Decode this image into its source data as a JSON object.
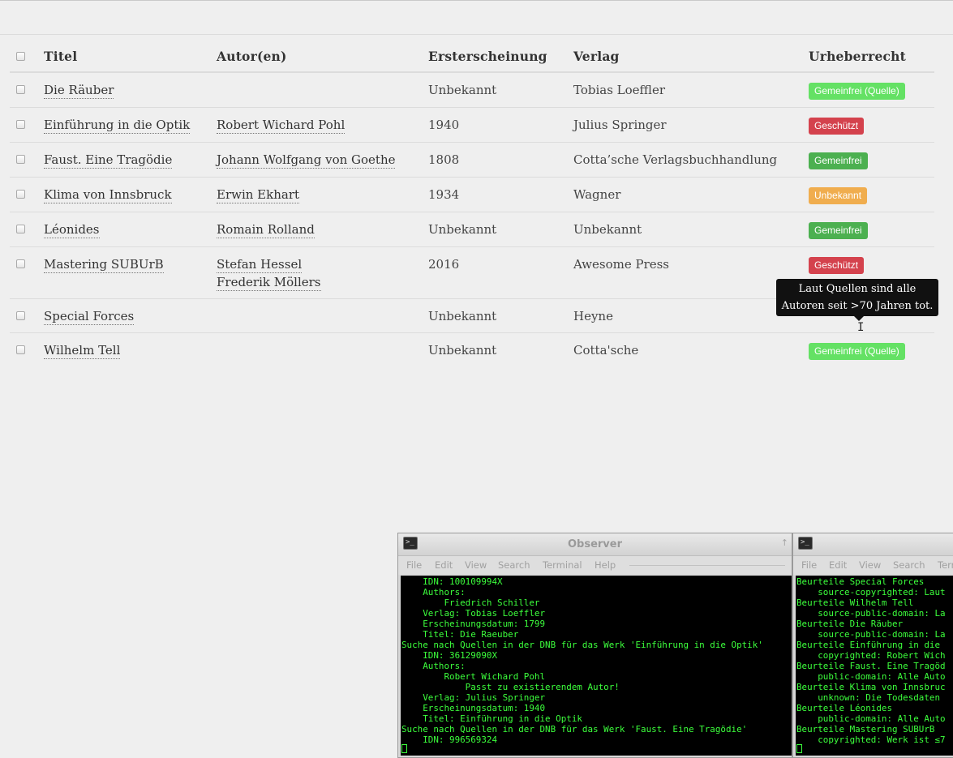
{
  "table": {
    "headers": [
      "Titel",
      "Autor(en)",
      "Ersterscheinung",
      "Verlag",
      "Urheberrecht"
    ],
    "rows": [
      {
        "title": "Die Räuber",
        "authors": [],
        "year": "Unbekannt",
        "publisher": "Tobias Loeffler",
        "copyright": "Gemeinfrei (Quelle)",
        "badge_color": "#64e164"
      },
      {
        "title": "Einführung in die Optik",
        "authors": [
          "Robert Wichard Pohl"
        ],
        "year": "1940",
        "publisher": "Julius Springer",
        "copyright": "Geschützt",
        "badge_color": "#d4424d"
      },
      {
        "title": "Faust. Eine Tragödie",
        "authors": [
          "Johann Wolfgang von Goethe"
        ],
        "year": "1808",
        "publisher": "Cotta’sche Verlagsbuchhandlung",
        "copyright": "Gemeinfrei",
        "badge_color": "#4cb050"
      },
      {
        "title": "Klima von Innsbruck",
        "authors": [
          "Erwin Ekhart"
        ],
        "year": "1934",
        "publisher": "Wagner",
        "copyright": "Unbekannt",
        "badge_color": "#f0ad4e"
      },
      {
        "title": "Léonides",
        "authors": [
          "Romain Rolland"
        ],
        "year": "Unbekannt",
        "publisher": "Unbekannt",
        "copyright": "Gemeinfrei",
        "badge_color": "#4cb050"
      },
      {
        "title": "Mastering SUBUrB",
        "authors": [
          "Stefan Hessel",
          "Frederik Möllers"
        ],
        "year": "2016",
        "publisher": "Awesome Press",
        "copyright": "Geschützt",
        "badge_color": "#d4424d"
      },
      {
        "title": "Special Forces",
        "authors": [],
        "year": "Unbekannt",
        "publisher": "Heyne",
        "copyright": "",
        "badge_color": ""
      },
      {
        "title": "Wilhelm Tell",
        "authors": [],
        "year": "Unbekannt",
        "publisher": "Cotta'sche",
        "copyright": "Gemeinfrei (Quelle)",
        "badge_color": "#64e164"
      }
    ]
  },
  "tooltip": {
    "line1": "Laut Quellen sind alle",
    "line2": "Autoren seit >70 Jahren tot."
  },
  "terminals": [
    {
      "title": "Observer",
      "menu": [
        "File",
        "Edit",
        "View",
        "Search",
        "Terminal",
        "Help"
      ],
      "text": "    IDN: 100109994X\n    Authors:\n        Friedrich Schiller\n    Verlag: Tobias Loeffler\n    Erscheinungsdatum: 1799\n    Titel: Die Raeuber\nSuche nach Quellen in der DNB für das Werk 'Einführung in die Optik'\n    IDN: 36129090X\n    Authors:\n        Robert Wichard Pohl\n            Passt zu existierendem Autor!\n    Verlag: Julius Springer\n    Erscheinungsdatum: 1940\n    Titel: Einführung in die Optik\nSuche nach Quellen in der DNB für das Werk 'Faust. Eine Tragödie'\n    IDN: 996569324"
    },
    {
      "title": "",
      "menu": [
        "File",
        "Edit",
        "View",
        "Search",
        "Term"
      ],
      "text": "Beurteile Special Forces\n    source-copyrighted: Laut\nBeurteile Wilhelm Tell\n    source-public-domain: La\nBeurteile Die Räuber\n    source-public-domain: La\nBeurteile Einführung in die\n    copyrighted: Robert Wich\nBeurteile Faust. Eine Tragöd\n    public-domain: Alle Auto\nBeurteile Klima von Innsbruc\n    unknown: Die Todesdaten\nBeurteile Léonides\n    public-domain: Alle Auto\nBeurteile Mastering SUBUrB\n    copyrighted: Werk ist ≤7"
    }
  ]
}
